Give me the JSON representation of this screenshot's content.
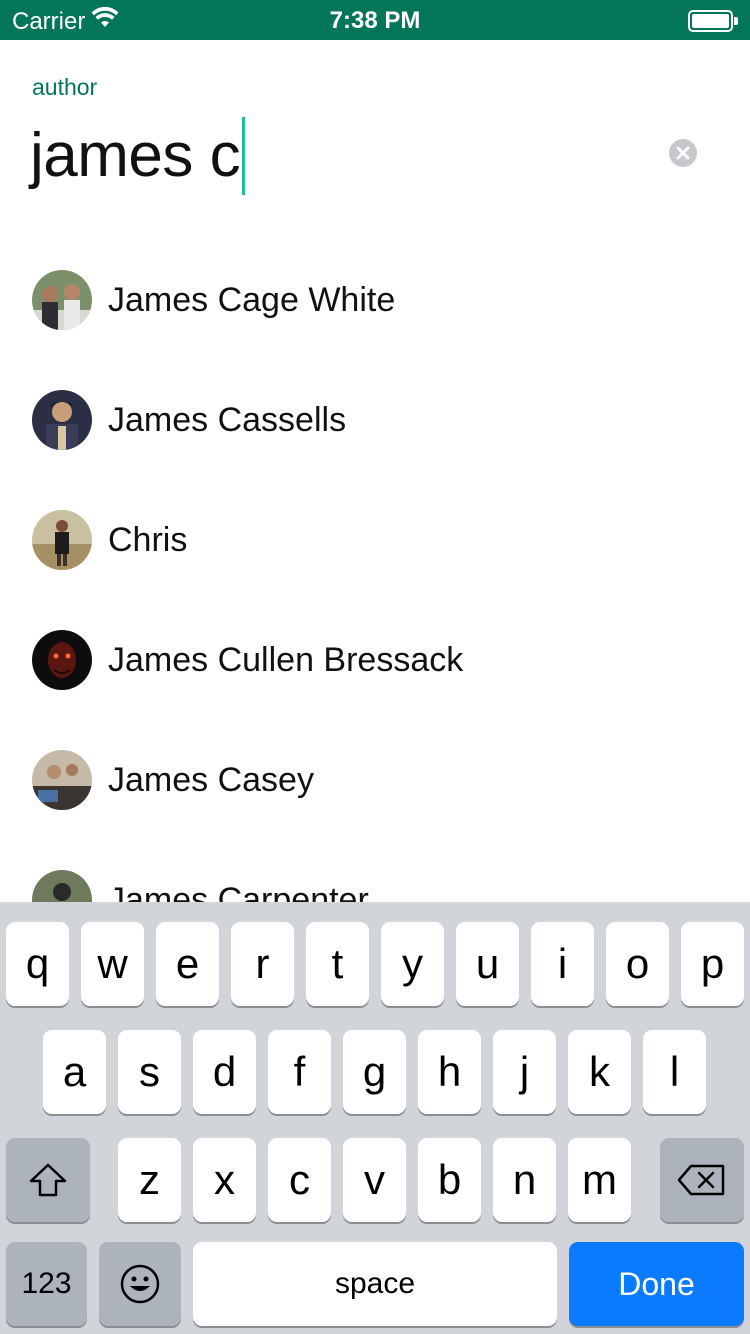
{
  "status_bar": {
    "carrier": "Carrier",
    "time": "7:38 PM",
    "icons": [
      "wifi-icon",
      "battery-icon"
    ],
    "background": "#037659"
  },
  "search": {
    "label": "author",
    "query": "james c",
    "accent_color": "#037659",
    "caret_color": "#1fbf9a"
  },
  "results": [
    {
      "name": "James Cage White"
    },
    {
      "name": "James Cassells"
    },
    {
      "name": "Chris"
    },
    {
      "name": "James Cullen Bressack"
    },
    {
      "name": "James Casey"
    },
    {
      "name": "James Carpenter"
    }
  ],
  "keyboard": {
    "row1": [
      "q",
      "w",
      "e",
      "r",
      "t",
      "y",
      "u",
      "i",
      "o",
      "p"
    ],
    "row2": [
      "a",
      "s",
      "d",
      "f",
      "g",
      "h",
      "j",
      "k",
      "l"
    ],
    "row3": [
      "z",
      "x",
      "c",
      "v",
      "b",
      "n",
      "m"
    ],
    "numbers_label": "123",
    "space_label": "space",
    "done_label": "Done",
    "icons": [
      "shift-icon",
      "backspace-icon",
      "emoji-icon"
    ],
    "done_color": "#0a7aff"
  }
}
